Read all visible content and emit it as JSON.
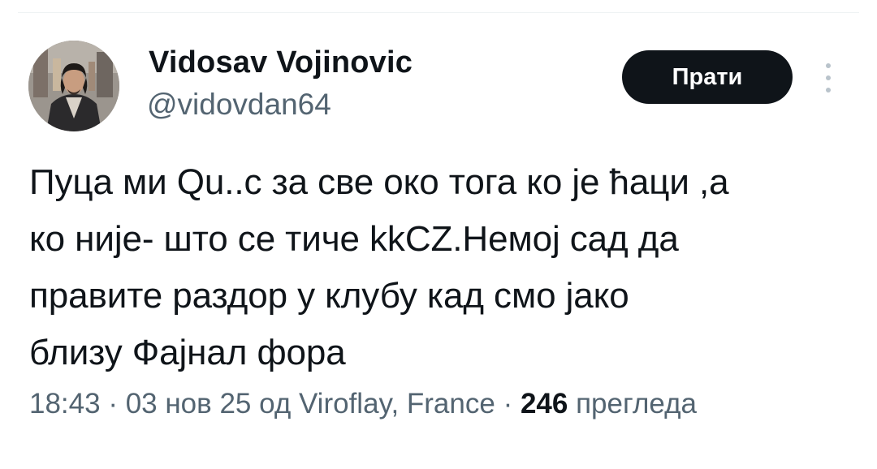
{
  "user": {
    "display_name": "Vidosav Vojinovic",
    "handle": "@vidovdan64"
  },
  "follow_button": {
    "label": "Прати"
  },
  "more_menu": {
    "icon": "vertical-ellipsis-icon"
  },
  "tweet": {
    "text": "Пуца ми Qu..с за све око тога ко је ћаци ,а\nко није- што се тиче kkCZ.Немој сад да\nправите раздор у клубу кад смо јако\nблизу Фајнал фора"
  },
  "meta": {
    "time": "18:43",
    "separator1": " · ",
    "date": "03 нов 25",
    "location": " од Viroflay, France",
    "separator2": " · ",
    "views_count": "246",
    "views_label": " прегледа"
  },
  "colors": {
    "text_primary": "#0f1419",
    "text_secondary": "#536471",
    "button_bg": "#0f1419",
    "button_text": "#ffffff"
  }
}
